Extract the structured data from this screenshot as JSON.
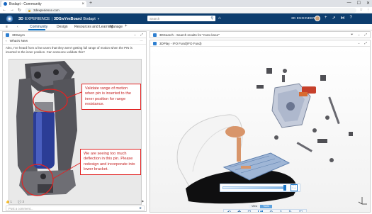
{
  "browser": {
    "tab_title": "Bodapt - Community",
    "new_tab": "+",
    "url": "3dexperience.com",
    "win_min": "—",
    "win_max": "☐",
    "win_close": "✕"
  },
  "app": {
    "brand_3d": "3D",
    "brand_rest": "EXPERIENCE",
    "app_name": "3DSwYmBoard",
    "app_context": "Bodapt",
    "search_placeholder": "Search",
    "user_label": "3D ENGINEER"
  },
  "tabs": [
    {
      "label": "Community",
      "active": true
    },
    {
      "label": "Design",
      "active": false
    },
    {
      "label": "Resources and Learning",
      "active": false
    },
    {
      "label": "Manage",
      "active": false
    },
    {
      "label": "+",
      "active": false
    }
  ],
  "left_panel": {
    "title": "3DSwym",
    "section_title": "What's New",
    "post_text": "Alex, I've heard from a few users that they aren't getting full range of motion when the PIN is inserted to the inner position. Can someone validate this?",
    "callout_top": "Validate range of motion when pin is inserted to the inner position for range resistance.",
    "callout_bottom": "We are seeing too much deflection in this pin. Please redesign and incorporate into lower bracket.",
    "likes": "1",
    "comments": "3",
    "comment_placeholder": "Post a comment..."
  },
  "search_panel": {
    "title": "3DSearch - Search results for \"moto knee\""
  },
  "viewer_panel": {
    "title": "3DPlay - IFO Fund(IFO Fund)",
    "view_tabs": [
      "View",
      "Tools"
    ],
    "active_view_tab": "Tools"
  },
  "colors": {
    "header_bg": "#0d3d6e",
    "accent": "#1b76c8",
    "callout": "#e22222"
  }
}
